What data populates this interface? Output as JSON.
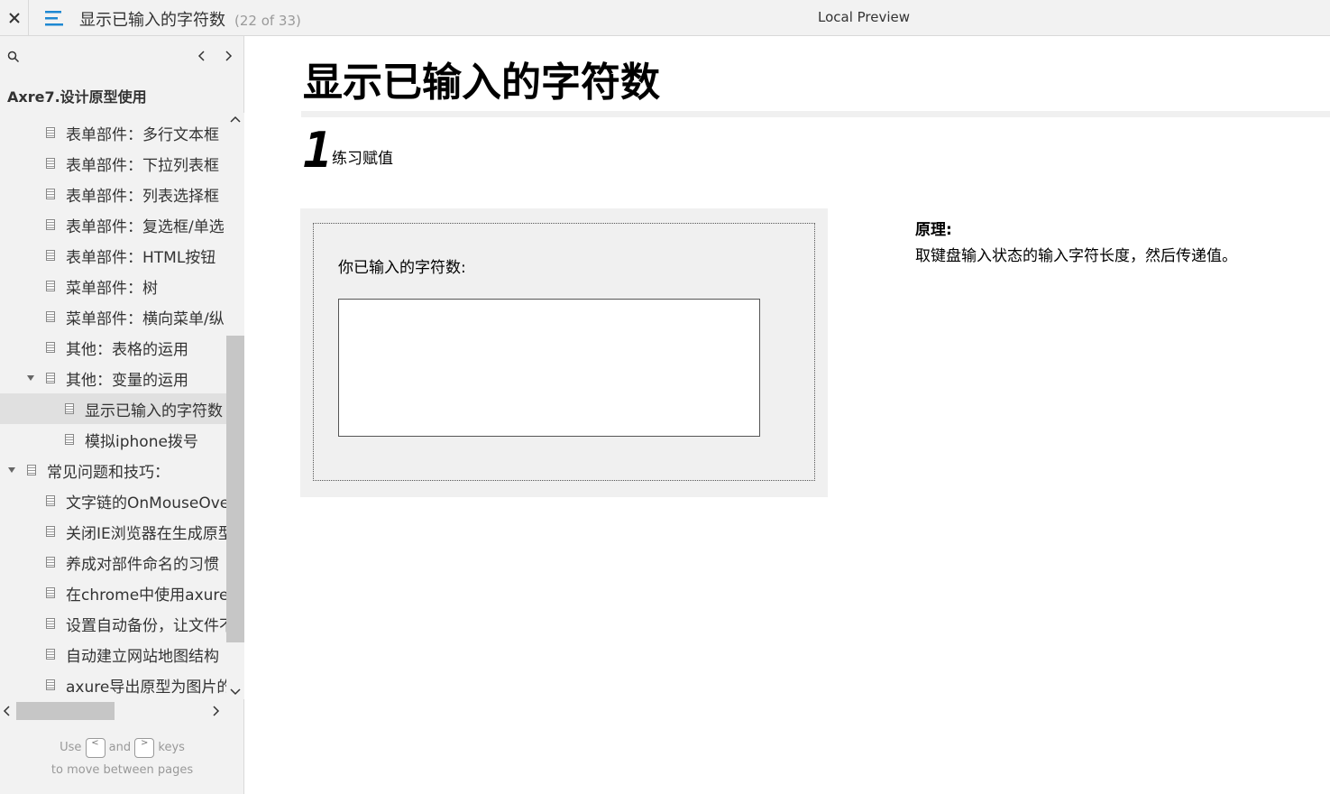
{
  "topbar": {
    "page_title": "显示已输入的字符数",
    "page_count": "(22 of 33)",
    "preview_label": "Local Preview"
  },
  "sidebar": {
    "project_title": "Axre7.设计原型使用",
    "items": [
      {
        "label": "表单部件：多行文本框"
      },
      {
        "label": "表单部件：下拉列表框"
      },
      {
        "label": "表单部件：列表选择框"
      },
      {
        "label": "表单部件：复选框/单选"
      },
      {
        "label": "表单部件：HTML按钮"
      },
      {
        "label": "菜单部件：树"
      },
      {
        "label": "菜单部件：横向菜单/纵"
      },
      {
        "label": "其他：表格的运用"
      },
      {
        "label": "其他：变量的运用"
      },
      {
        "label": "显示已输入的字符数"
      },
      {
        "label": "模拟iphone拨号"
      },
      {
        "label": "常见问题和技巧："
      },
      {
        "label": "文字链的OnMouseOver效"
      },
      {
        "label": "关闭IE浏览器在生成原型"
      },
      {
        "label": "养成对部件命名的习惯"
      },
      {
        "label": "在chrome中使用axure生"
      },
      {
        "label": "设置自动备份，让文件不"
      },
      {
        "label": "自动建立网站地图结构"
      },
      {
        "label": "axure导出原型为图片的"
      }
    ],
    "hint": {
      "use": "Use",
      "and": "and",
      "keys": "keys",
      "line2": "to move between pages",
      "key1": "<",
      "key2": ">"
    }
  },
  "main": {
    "heading": "显示已输入的字符数",
    "step_number": "1",
    "step_text": "练习赋值",
    "count_label": "你已输入的字符数:",
    "principle_title": "原理:",
    "principle_text": "取键盘输入状态的输入字符长度，然后传递值。"
  }
}
